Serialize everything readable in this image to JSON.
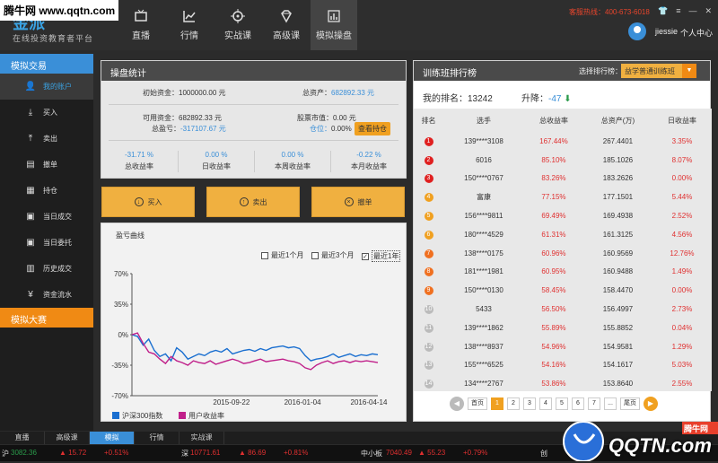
{
  "watermark": "腾牛网 www.qqtn.com",
  "brand": {
    "name": "金派",
    "slogan": "在线投资教育者平台"
  },
  "nav": [
    {
      "label": "直播",
      "icon": "tv-icon"
    },
    {
      "label": "行情",
      "icon": "chart-line-icon"
    },
    {
      "label": "实战课",
      "icon": "target-icon"
    },
    {
      "label": "高级课",
      "icon": "diamond-icon"
    },
    {
      "label": "模拟操盘",
      "icon": "bar-chart-icon",
      "active": true
    }
  ],
  "header": {
    "hotline": "客服热线：400-673-6018",
    "username": "jiessie",
    "center": "个人中心"
  },
  "sidebar": {
    "section1": "模拟交易",
    "items": [
      {
        "label": "我的账户",
        "icon": "user-icon",
        "active": true
      },
      {
        "label": "买入",
        "icon": "download-icon"
      },
      {
        "label": "卖出",
        "icon": "upload-icon"
      },
      {
        "label": "撤单",
        "icon": "cancel-doc-icon"
      },
      {
        "label": "持仓",
        "icon": "grid-icon"
      },
      {
        "label": "当日成交",
        "icon": "calendar-icon"
      },
      {
        "label": "当日委托",
        "icon": "calendar-icon"
      },
      {
        "label": "历史成交",
        "icon": "document-icon"
      },
      {
        "label": "资金流水",
        "icon": "yen-icon"
      }
    ],
    "section2": "模拟大赛"
  },
  "stats": {
    "title": "操盘统计",
    "initial_label": "初始资金：",
    "initial_value": "1000000.00 元",
    "total_label": "总资产：",
    "total_value": "682892.33 元",
    "avail_label": "可用资金：",
    "avail_value": "682892.33 元",
    "market_label": "股票市值：",
    "market_value": "0.00 元",
    "pnl_label": "总盈亏：",
    "pnl_value": "-317107.67 元",
    "position_label": "仓位：",
    "position_value": "0.00%",
    "hold_button": "查看持仓",
    "summary": [
      {
        "value": "-31.71 %",
        "label": "总收益率"
      },
      {
        "value": "0.00 %",
        "label": "日收益率"
      },
      {
        "value": "0.00 %",
        "label": "本周收益率"
      },
      {
        "value": "-0.22 %",
        "label": "本月收益率"
      }
    ]
  },
  "actions": {
    "buy": "买入",
    "sell": "卖出",
    "cancel": "撤单"
  },
  "chart_panel": {
    "title": "盈亏曲线",
    "options": [
      {
        "label": "最近1个月",
        "checked": false
      },
      {
        "label": "最近3个月",
        "checked": false
      },
      {
        "label": "最近1年",
        "checked": true
      }
    ]
  },
  "chart_data": {
    "type": "line",
    "title": "",
    "xlabel": "",
    "ylabel": "",
    "yticks": [
      "70%",
      "35%",
      "0%",
      "-35%",
      "-70%"
    ],
    "ylim": [
      -70,
      70
    ],
    "xticks": [
      "2015-09-22",
      "2016-01-04",
      "2016-04-14"
    ],
    "grid": false,
    "legend_position": "bottom-left",
    "series": [
      {
        "name": "沪深300指数",
        "color": "#1a6fd0",
        "values": [
          0,
          -2,
          -12,
          -5,
          -18,
          -25,
          -22,
          -30,
          -15,
          -20,
          -28,
          -25,
          -22,
          -24,
          -20,
          -18,
          -20,
          -16,
          -22,
          -20,
          -18,
          -17,
          -19,
          -16,
          -18,
          -15,
          -14,
          -13,
          -15,
          -14,
          -16,
          -24,
          -30,
          -28,
          -27,
          -25,
          -22,
          -26,
          -24,
          -22,
          -25,
          -23,
          -24,
          -22,
          -23
        ]
      },
      {
        "name": "用户收益率",
        "color": "#c0208a",
        "values": [
          0,
          2,
          -10,
          -20,
          -22,
          -28,
          -33,
          -25,
          -30,
          -32,
          -35,
          -30,
          -32,
          -33,
          -30,
          -34,
          -32,
          -30,
          -28,
          -30,
          -33,
          -32,
          -30,
          -28,
          -31,
          -30,
          -29,
          -28,
          -30,
          -31,
          -33,
          -38,
          -40,
          -35,
          -32,
          -30,
          -33,
          -31,
          -30,
          -32,
          -30,
          -31,
          -30,
          -31,
          -32
        ]
      }
    ]
  },
  "rank": {
    "title": "训练班排行榜",
    "select_label": "选择排行榜：",
    "select_value": "益学普通训练班",
    "my_rank_label": "我的排名：",
    "my_rank": "13242",
    "rise_label": "升降：",
    "rise": "-47",
    "columns": [
      "排名",
      "选手",
      "总收益率",
      "总资产(万)",
      "日收益率"
    ],
    "rows": [
      {
        "rank": "1",
        "name": "139****3108",
        "total": "167.44%",
        "assets": "267.4401",
        "daily": "3.35%",
        "color": "#e02020"
      },
      {
        "rank": "2",
        "name": "6016",
        "total": "85.10%",
        "assets": "185.1026",
        "daily": "8.07%",
        "color": "#e02020"
      },
      {
        "rank": "3",
        "name": "150****0767",
        "total": "83.26%",
        "assets": "183.2626",
        "daily": "0.00%",
        "color": "#e02020"
      },
      {
        "rank": "4",
        "name": "富康",
        "total": "77.15%",
        "assets": "177.1501",
        "daily": "5.44%",
        "color": "#f0a020"
      },
      {
        "rank": "5",
        "name": "156****9811",
        "total": "69.49%",
        "assets": "169.4938",
        "daily": "2.52%",
        "color": "#f0a020"
      },
      {
        "rank": "6",
        "name": "180****4529",
        "total": "61.31%",
        "assets": "161.3125",
        "daily": "4.56%",
        "color": "#f0a020"
      },
      {
        "rank": "7",
        "name": "138****0175",
        "total": "60.96%",
        "assets": "160.9569",
        "daily": "12.76%",
        "color": "#f07020"
      },
      {
        "rank": "8",
        "name": "181****1981",
        "total": "60.95%",
        "assets": "160.9488",
        "daily": "1.49%",
        "color": "#f07020"
      },
      {
        "rank": "9",
        "name": "150****0130",
        "total": "58.45%",
        "assets": "158.4470",
        "daily": "0.00%",
        "color": "#f07020"
      },
      {
        "rank": "10",
        "name": "5433",
        "total": "56.50%",
        "assets": "156.4997",
        "daily": "2.73%",
        "color": "#bbbbbb"
      },
      {
        "rank": "11",
        "name": "139****1862",
        "total": "55.89%",
        "assets": "155.8852",
        "daily": "0.04%",
        "color": "#bbbbbb"
      },
      {
        "rank": "12",
        "name": "138****8937",
        "total": "54.96%",
        "assets": "154.9581",
        "daily": "1.29%",
        "color": "#bbbbbb"
      },
      {
        "rank": "13",
        "name": "155****6525",
        "total": "54.16%",
        "assets": "154.1617",
        "daily": "5.03%",
        "color": "#bbbbbb"
      },
      {
        "rank": "14",
        "name": "134****2767",
        "total": "53.86%",
        "assets": "153.8640",
        "daily": "2.55%",
        "color": "#bbbbbb"
      }
    ],
    "pager": [
      "首页",
      "1",
      "2",
      "3",
      "4",
      "5",
      "6",
      "7",
      "...",
      "尾页"
    ]
  },
  "bottom_tabs": [
    "直播",
    "高级课",
    "模拟",
    "行情",
    "实战课"
  ],
  "ticker": [
    {
      "label": "沪",
      "value": "3082.36",
      "change": "15.72",
      "pct": "+0.51%"
    },
    {
      "label": "深",
      "value": "10771.61",
      "change": "86.69",
      "pct": "+0.81%"
    },
    {
      "label": "中小板",
      "value": "7040.49",
      "change": "55.23",
      "pct": "+0.79%"
    },
    {
      "label": "创",
      "value": "",
      "change": "",
      "pct": ""
    }
  ],
  "watermark2": {
    "text": "QQTN.com",
    "badge": "腾牛网"
  }
}
